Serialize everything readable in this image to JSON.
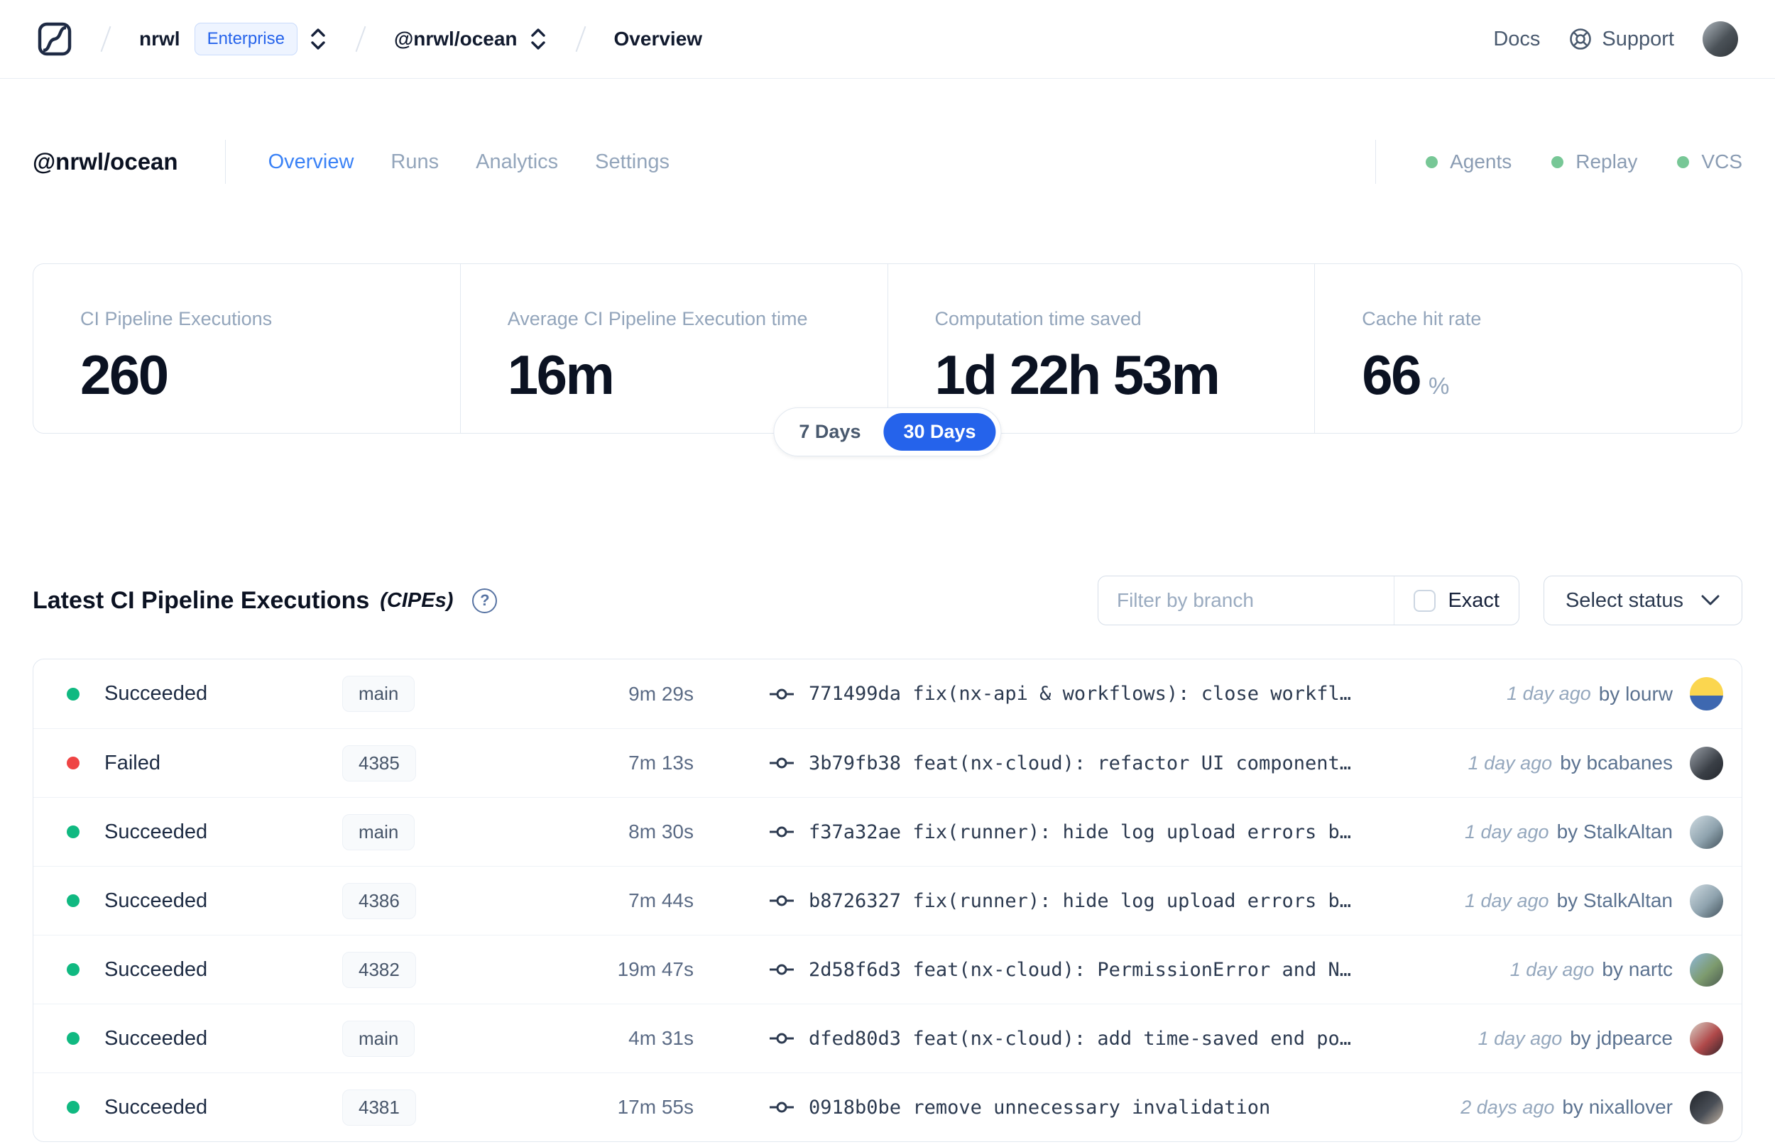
{
  "colors": {
    "accent_blue": "#2563eb",
    "active_tab_blue": "#3b82f6",
    "header_status_dot_green": "#77c796",
    "status": {
      "Succeeded": "#10b981",
      "Failed": "#ef4444"
    }
  },
  "navbar": {
    "breadcrumb": {
      "org": "nrwl",
      "org_badge": "Enterprise",
      "workspace": "@nrwl/ocean",
      "page": "Overview"
    },
    "docs_label": "Docs",
    "support_label": "Support",
    "user_avatar_bg": "linear-gradient(135deg,#aeb6bd 0%,#4b5258 55%,#2e3338 100%)"
  },
  "header": {
    "title": "@nrwl/ocean",
    "tabs": [
      {
        "label": "Overview",
        "active": true
      },
      {
        "label": "Runs",
        "active": false
      },
      {
        "label": "Analytics",
        "active": false
      },
      {
        "label": "Settings",
        "active": false
      }
    ],
    "statuses": [
      {
        "label": "Agents"
      },
      {
        "label": "Replay"
      },
      {
        "label": "VCS"
      }
    ]
  },
  "stats": {
    "cards": [
      {
        "label": "CI Pipeline Executions",
        "value": "260",
        "suffix": ""
      },
      {
        "label": "Average CI Pipeline Execution time",
        "value": "16m",
        "suffix": ""
      },
      {
        "label": "Computation time saved",
        "value": "1d 22h 53m",
        "suffix": ""
      },
      {
        "label": "Cache hit rate",
        "value": "66",
        "suffix": "%"
      }
    ],
    "range_toggle": {
      "options": [
        "7 Days",
        "30 Days"
      ],
      "selected": "30 Days"
    }
  },
  "section": {
    "title": "Latest CI Pipeline Executions",
    "subtitle": "(CIPEs)",
    "filter_placeholder": "Filter by branch",
    "exact_label": "Exact",
    "status_dropdown_label": "Select status"
  },
  "table": {
    "rows": [
      {
        "status": "Succeeded",
        "branch": "main",
        "duration": "9m 29s",
        "commit_sha": "771499da",
        "commit_message": "fix(nx-api & workflows): close workfl…",
        "time": "1 day ago",
        "author": "by lourw",
        "avatar_bg": "linear-gradient(180deg,#fbd64f 0%,#fbd64f 55%,#3e68b0 55%,#3e68b0 100%)"
      },
      {
        "status": "Failed",
        "branch": "4385",
        "duration": "7m 13s",
        "commit_sha": "3b79fb38",
        "commit_message": "feat(nx-cloud): refactor UI component…",
        "time": "1 day ago",
        "author": "by bcabanes",
        "avatar_bg": "linear-gradient(135deg,#9aa0a8 0%,#3a3f46 60%,#23272d 100%)"
      },
      {
        "status": "Succeeded",
        "branch": "main",
        "duration": "8m 30s",
        "commit_sha": "f37a32ae",
        "commit_message": "fix(runner): hide log upload errors b…",
        "time": "1 day ago",
        "author": "by StalkAltan",
        "avatar_bg": "linear-gradient(135deg,#cfdbe2 0%,#8fa3ae 55%,#42525c 100%)"
      },
      {
        "status": "Succeeded",
        "branch": "4386",
        "duration": "7m 44s",
        "commit_sha": "b8726327",
        "commit_message": "fix(runner): hide log upload errors b…",
        "time": "1 day ago",
        "author": "by StalkAltan",
        "avatar_bg": "linear-gradient(135deg,#cfdbe2 0%,#8fa3ae 55%,#42525c 100%)"
      },
      {
        "status": "Succeeded",
        "branch": "4382",
        "duration": "19m 47s",
        "commit_sha": "2d58f6d3",
        "commit_message": "feat(nx-cloud): PermissionError and N…",
        "time": "1 day ago",
        "author": "by nartc",
        "avatar_bg": "linear-gradient(135deg,#8fb7d9 0%,#7d9b6e 55%,#4a5a50 100%)"
      },
      {
        "status": "Succeeded",
        "branch": "main",
        "duration": "4m 31s",
        "commit_sha": "dfed80d3",
        "commit_message": "feat(nx-cloud): add time-saved end po…",
        "time": "1 day ago",
        "author": "by jdpearce",
        "avatar_bg": "linear-gradient(135deg,#d9d2c8 0%,#b0494a 55%,#33232a 100%)"
      },
      {
        "status": "Succeeded",
        "branch": "4381",
        "duration": "17m 55s",
        "commit_sha": "0918b0be",
        "commit_message": "remove unnecessary invalidation",
        "time": "2 days ago",
        "author": "by nixallover",
        "avatar_bg": "linear-gradient(135deg,#20242a 0%,#4a4f57 55%,#c3b4a4 100%)"
      }
    ]
  }
}
